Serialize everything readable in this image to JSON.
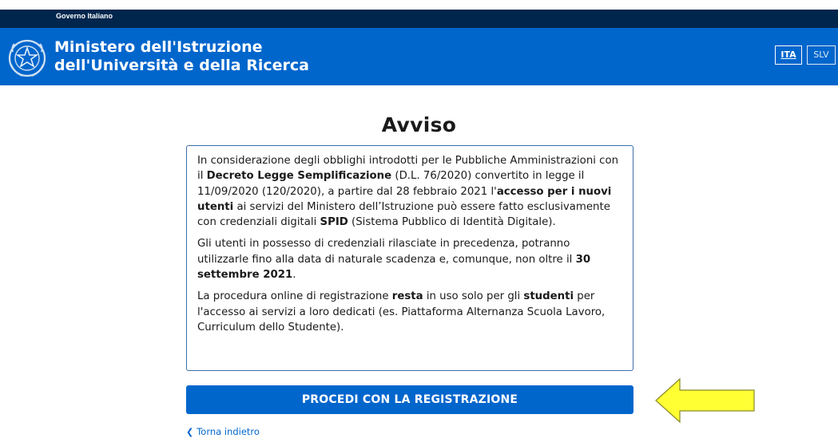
{
  "topbar": {
    "label": "Governo Italiano"
  },
  "header": {
    "title_line1": "Ministero dell'Istruzione",
    "title_line2": "dell'Università e della Ricerca",
    "emblem_icon": "italian-republic-emblem-icon",
    "languages": [
      {
        "code": "ITA",
        "active": true
      },
      {
        "code": "SLV",
        "active": false
      }
    ]
  },
  "main": {
    "title": "Avviso",
    "notice": {
      "p1": {
        "t1": "In considerazione degli obblighi introdotti per le Pubbliche Amministrazioni con il ",
        "b1": "Decreto Legge Semplificazione",
        "t2": " (D.L. 76/2020) convertito in legge il 11/09/2020 (120/2020), a partire dal 28 febbraio 2021 l'",
        "b2": "accesso per i nuovi utenti",
        "t3": " ai servizi del Ministero dell’Istruzione può essere fatto esclusivamente con credenziali digitali ",
        "b3": "SPID",
        "t4": " (Sistema Pubblico di Identità Digitale)."
      },
      "p2": {
        "t1": "Gli utenti in possesso di credenziali rilasciate in precedenza, potranno utilizzarle fino alla data di naturale scadenza e, comunque, non oltre il ",
        "b1": "30 settembre 2021",
        "t2": "."
      },
      "p3": {
        "t1": "La procedura online di registrazione ",
        "b1": "resta",
        "t2": " in uso solo per gli ",
        "b2": "studenti",
        "t3": " per l'accesso ai servizi a loro dedicati (es. Piattaforma Alternanza Scuola Lavoro, Curriculum dello Studente)."
      }
    },
    "primary_button": "PROCEDI CON LA REGISTRAZIONE",
    "back_link": "Torna indietro"
  },
  "annotation": {
    "arrow_color": "#ffff33",
    "arrow_icon": "left-arrow-icon"
  },
  "colors": {
    "brand_blue": "#0066cc",
    "topbar_navy": "#00264d",
    "notice_border": "#3d6fa8"
  }
}
